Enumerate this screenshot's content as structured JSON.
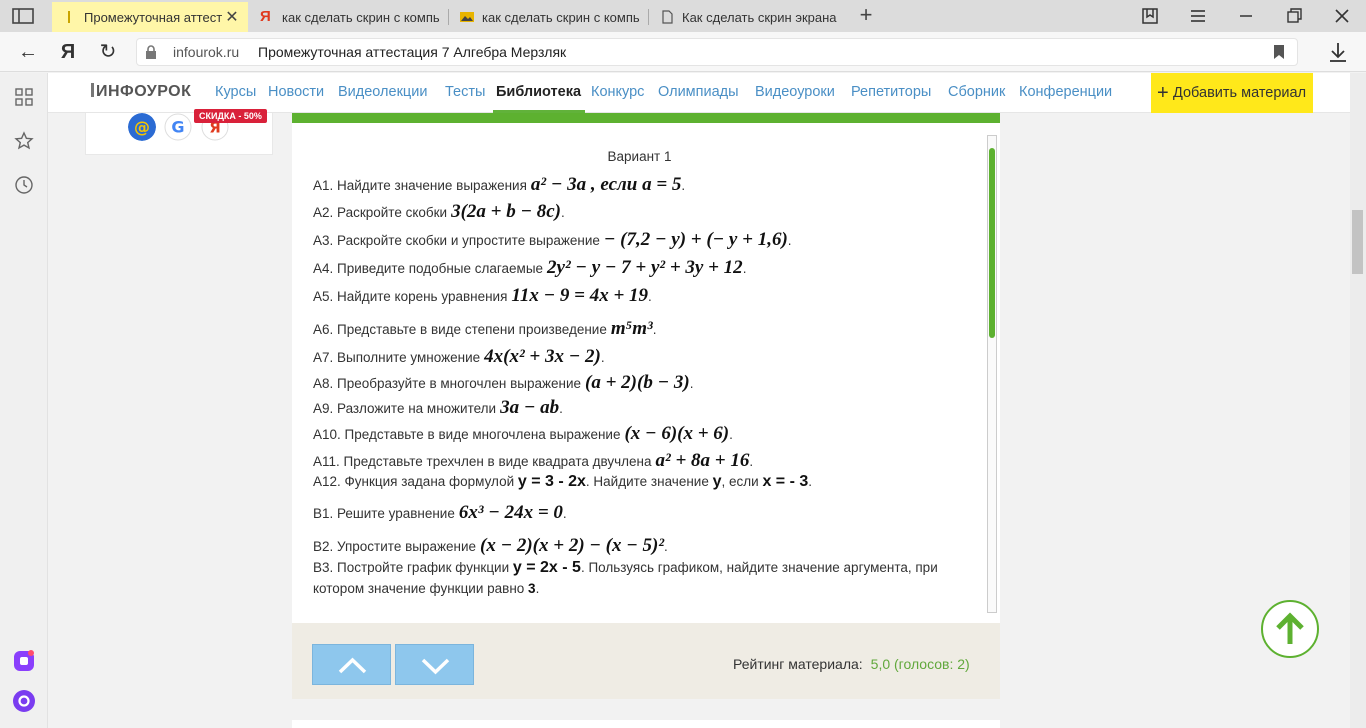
{
  "browser": {
    "tabs": [
      {
        "title": "Промежуточная аттеста",
        "active": true,
        "favicon": "infourok-favicon-icon"
      },
      {
        "title": "как сделать скрин с компь",
        "active": false,
        "favicon": "yandex-favicon-icon"
      },
      {
        "title": "как сделать скрин с компь",
        "active": false,
        "favicon": "image-favicon-icon"
      },
      {
        "title": "Как сделать скрин экрана",
        "active": false,
        "favicon": "page-favicon-icon"
      }
    ],
    "new_tab_symbol": "+",
    "yandex_logo": "Я",
    "address": {
      "host": "infourok.ru",
      "page_title": "Промежуточная аттестация 7 Алгебра Мерзляк"
    }
  },
  "site": {
    "logo": "ИНФОУРОК",
    "nav": [
      "Курсы",
      "Новости",
      "Видеолекции",
      "Тесты",
      "Библиотека",
      "Конкурс",
      "Олимпиады",
      "Видеоуроки",
      "Репетиторы",
      "Сборник",
      "Конференции"
    ],
    "active_nav": "Библиотека",
    "add_material": "Добавить материал",
    "sale_badge": "СКИДКА - 50%"
  },
  "document": {
    "variant": "Вариант 1",
    "questions": [
      {
        "label": "А1. Найдите значение выражения",
        "math": "a² − 3a , если  a = 5",
        "end": "."
      },
      {
        "label": "А2. Раскройте скобки",
        "math": "3(2a + b − 8c)",
        "end": "."
      },
      {
        "label": "А3. Раскройте скобки и упростите выражение",
        "math": "− (7,2 − y) + (− y + 1,6)",
        "end": "."
      },
      {
        "label": "А4. Приведите подобные слагаемые",
        "math": "2y² − y − 7 + y² + 3y + 12",
        "end": "."
      },
      {
        "label": "А5. Найдите корень уравнения",
        "math": "11x − 9 = 4x + 19",
        "end": "."
      },
      {
        "label": "А6. Представьте в виде степени произведение",
        "math": "m⁵m³",
        "end": "."
      },
      {
        "label": "А7. Выполните умножение",
        "math": "4x(x² + 3x − 2)",
        "end": "."
      },
      {
        "label": "А8. Преобразуйте в многочлен выражение",
        "math": "(a + 2)(b − 3)",
        "end": "."
      },
      {
        "label": "А9. Разложите на множители",
        "math": "3a − ab",
        "end": "."
      },
      {
        "label": "А10. Представьте в виде многочлена выражение",
        "math": "(x − 6)(x + 6)",
        "end": "."
      },
      {
        "label": "А11. Представьте трехчлен в виде квадрата двучлена",
        "math": "a² + 8a + 16",
        "end": "."
      },
      {
        "label": "В1. Решите уравнение",
        "math": "6x³ − 24x = 0",
        "end": "."
      },
      {
        "label": "В2. Упростите выражение",
        "math": "(x − 2)(x + 2) − (x − 5)²",
        "end": "."
      }
    ],
    "a12": {
      "p1": "А12. Функция задана формулой ",
      "f": "y = 3 - 2x",
      "p2": ". Найдите значение ",
      "v": "у",
      "p3": ", если ",
      "c": "х = - 3",
      "p4": "."
    },
    "b3": {
      "p1": "В3. Постройте график функции ",
      "f": "у = 2х - 5",
      "p2": ". Пользуясь графиком, найдите значение аргумента, при котором значение функции равно ",
      "v": "3",
      "p3": "."
    }
  },
  "rating": {
    "label": "Рейтинг материала:",
    "value": "5,0 (голосов: 2)"
  },
  "colors": {
    "accent_green": "#5db130",
    "link_blue": "#4a8fc5",
    "add_button_yellow": "#ffe81a",
    "active_tab": "#fff6a8"
  }
}
